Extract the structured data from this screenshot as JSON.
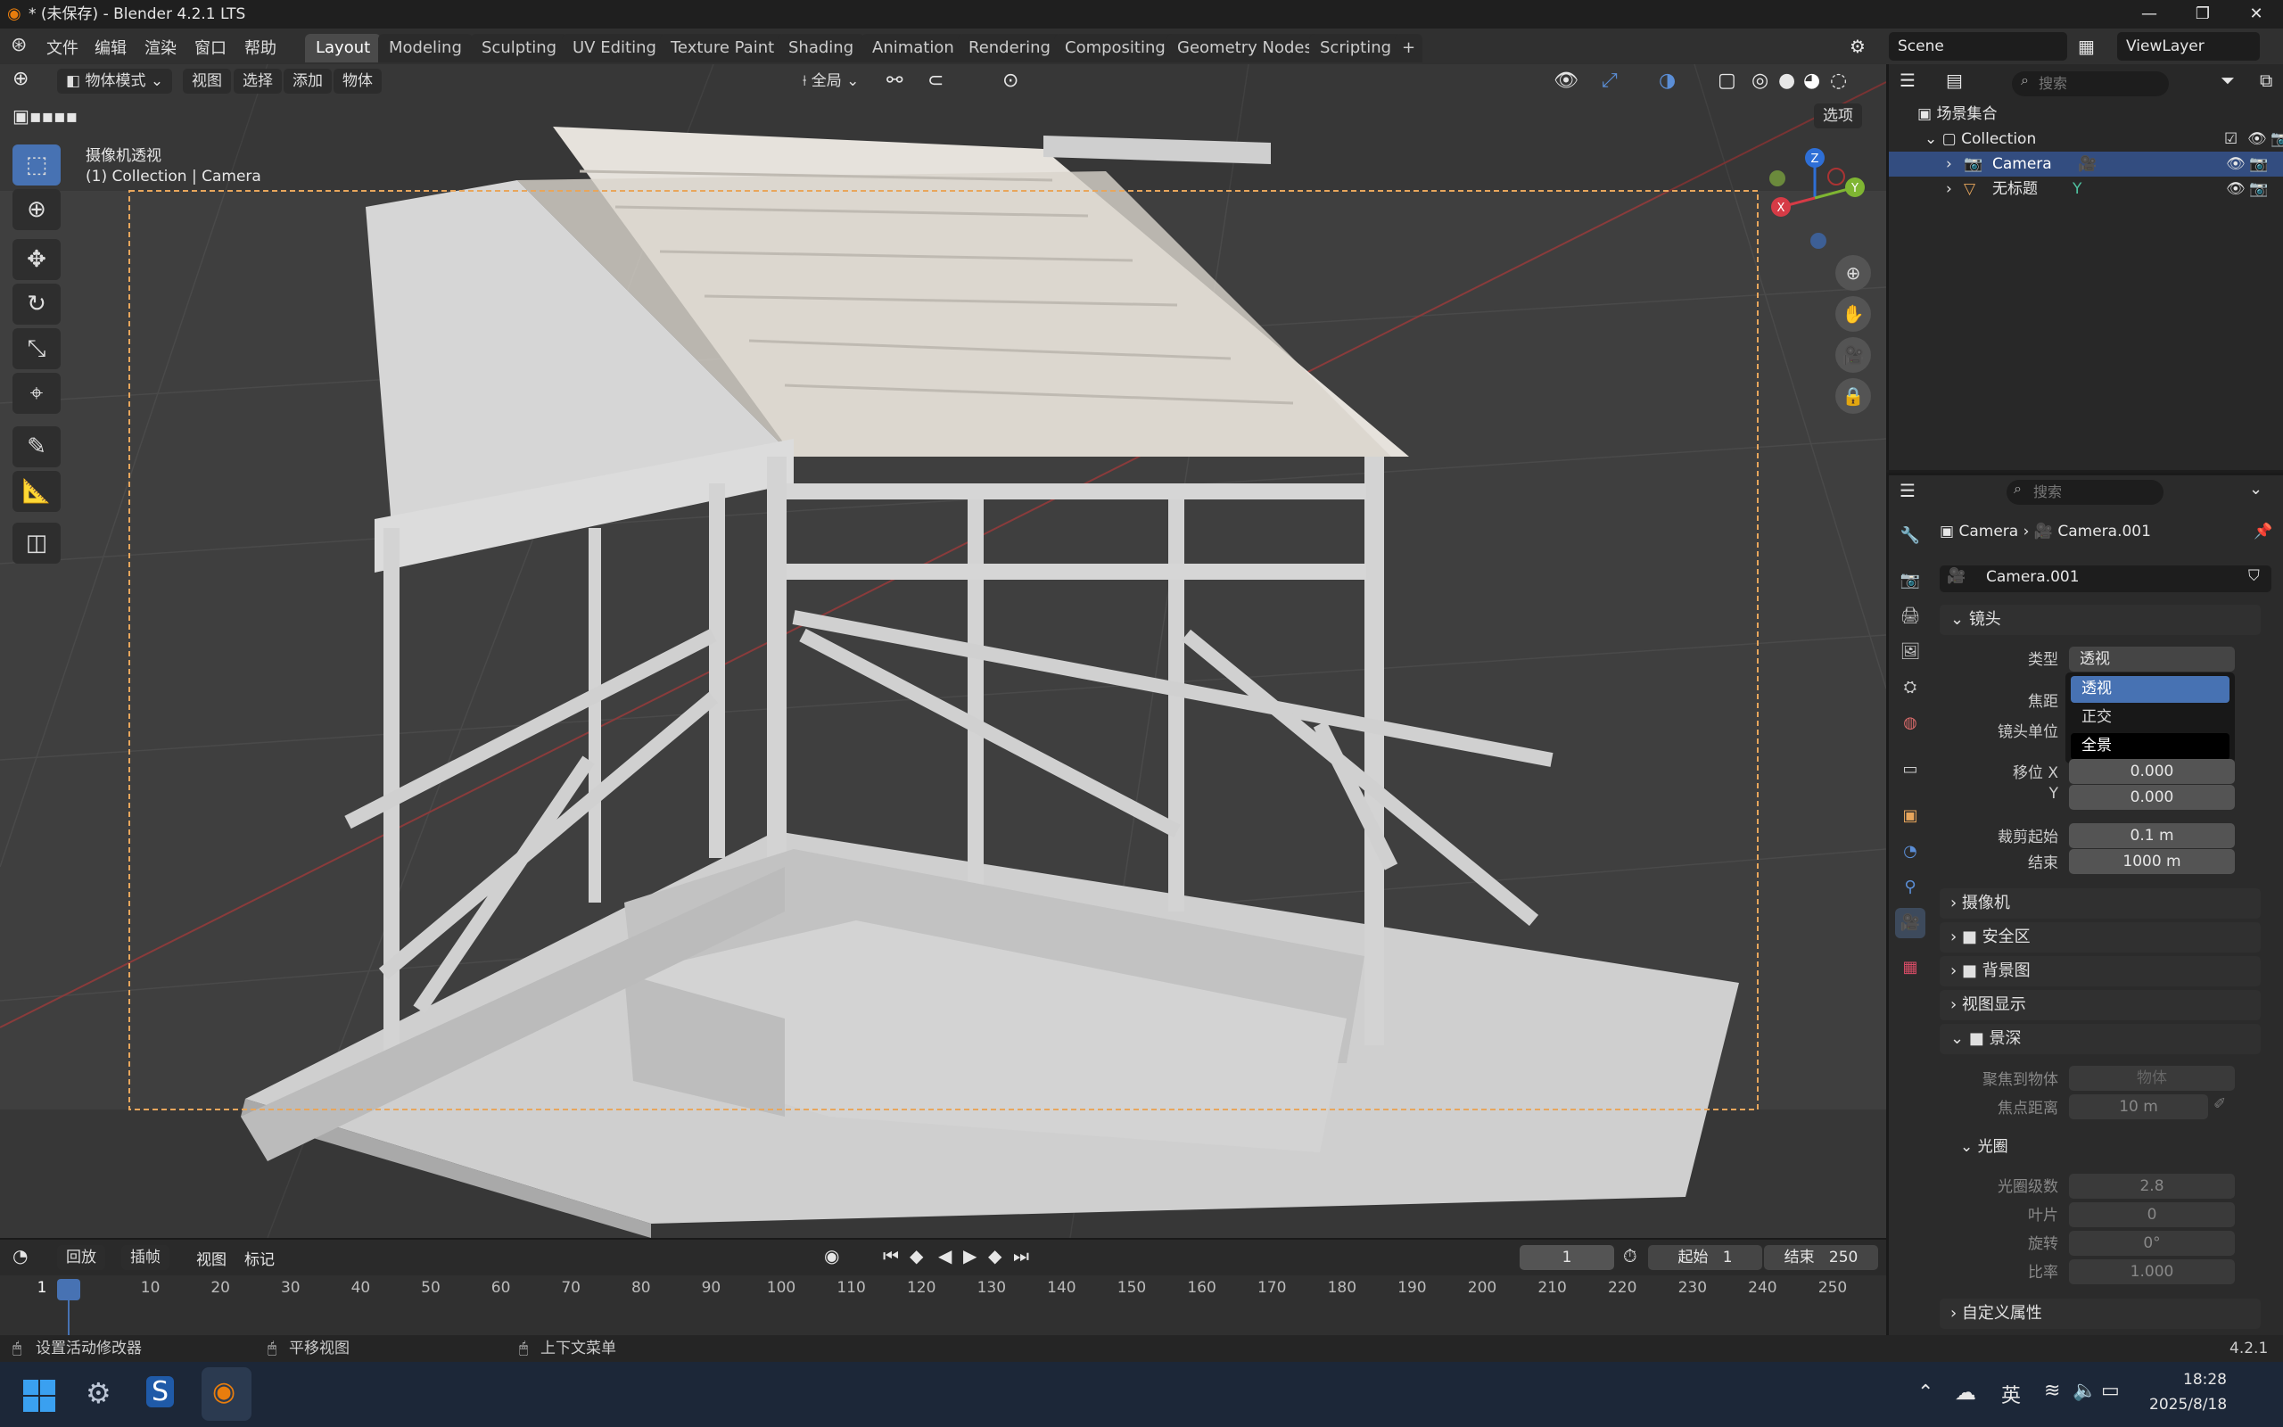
{
  "titlebar": {
    "title": "* (未保存) - Blender 4.2.1 LTS",
    "min": "—",
    "max": "❐",
    "close": "✕"
  },
  "menus": [
    "文件",
    "编辑",
    "渲染",
    "窗口",
    "帮助"
  ],
  "tabs": [
    "Layout",
    "Modeling",
    "Sculpting",
    "UV Editing",
    "Texture Paint",
    "Shading",
    "Animation",
    "Rendering",
    "Compositing",
    "Geometry Nodes",
    "Scripting"
  ],
  "add_tab": "+",
  "scene": {
    "scene_name": "Scene",
    "view_layer": "ViewLayer"
  },
  "viewport": {
    "mode": "物体模式",
    "menu_view": "视图",
    "menu_select": "选择",
    "menu_add": "添加",
    "menu_object": "物体",
    "transform": "全局",
    "options": "选项",
    "overlay_line1": "摄像机透视",
    "overlay_line2": "(1) Collection | Camera",
    "axes": {
      "x": "X",
      "y": "Y",
      "z": "Z"
    }
  },
  "outliner": {
    "search_placeholder": "搜索",
    "root": "场景集合",
    "collection": "Collection",
    "camera": "Camera",
    "object": "无标题"
  },
  "props": {
    "search_placeholder": "搜索",
    "breadcrumb_obj": "Camera",
    "breadcrumb_data": "Camera.001",
    "datablock": "Camera.001",
    "lens_panel": "镜头",
    "type_label": "类型",
    "type_value": "透视",
    "dropdown": [
      "透视",
      "正交",
      "全景"
    ],
    "focal_label": "焦距",
    "unit_label": "镜头单位",
    "shift_x_label": "移位 X",
    "shift_x": "0.000",
    "shift_y_label": "Y",
    "shift_y": "0.000",
    "clip_start_label": "裁剪起始",
    "clip_start": "0.1 m",
    "clip_end_label": "结束",
    "clip_end": "1000 m",
    "camera_panel": "摄像机",
    "safe_panel": "安全区",
    "bg_panel": "背景图",
    "display_panel": "视图显示",
    "dof_panel": "景深",
    "focus_obj_label": "聚焦到物体",
    "focus_obj_placeholder": "物体",
    "focus_dist_label": "焦点距离",
    "focus_dist": "10 m",
    "aperture_panel": "光圈",
    "fstop_label": "光圈级数",
    "fstop": "2.8",
    "blades_label": "叶片",
    "blades": "0",
    "rotation_label": "旋转",
    "rotation": "0°",
    "ratio_label": "比率",
    "ratio": "1.000",
    "custom_panel": "自定义属性"
  },
  "timeline": {
    "playback": "回放",
    "keying": "插帧",
    "view": "视图",
    "marker": "标记",
    "current_frame": "1",
    "start_label": "起始",
    "start": "1",
    "end_label": "结束",
    "end": "250",
    "ticks": [
      "1",
      "10",
      "20",
      "30",
      "40",
      "50",
      "60",
      "70",
      "80",
      "90",
      "100",
      "110",
      "120",
      "130",
      "140",
      "150",
      "160",
      "170",
      "180",
      "190",
      "200",
      "210",
      "220",
      "230",
      "240",
      "250"
    ]
  },
  "status": {
    "left": "设置活动修改器",
    "middle": "平移视图",
    "right": "上下文菜单",
    "version": "4.2.1"
  },
  "taskbar": {
    "ime": "英",
    "time": "18:28",
    "date": "2025/8/18"
  }
}
